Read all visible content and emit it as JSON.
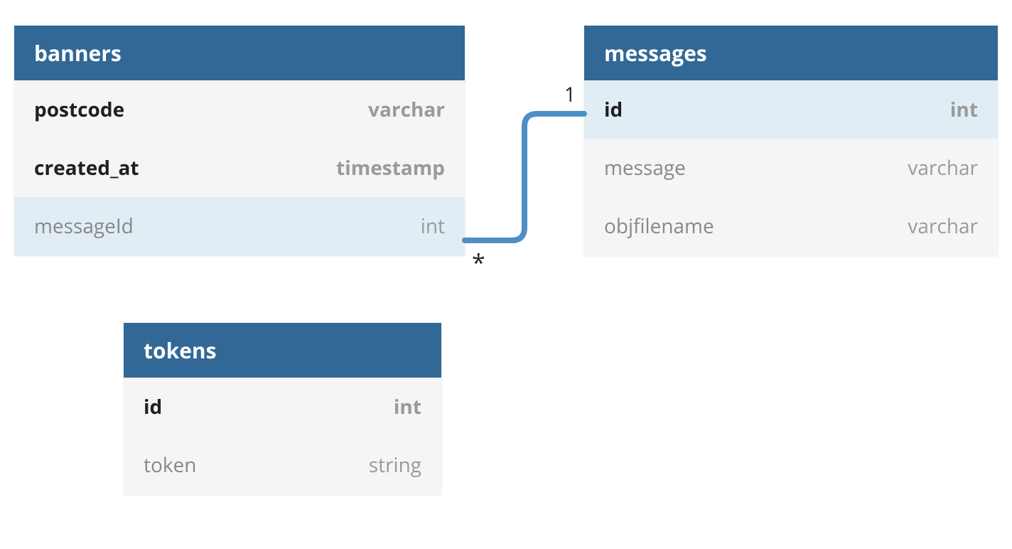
{
  "tables": {
    "banners": {
      "title": "banners",
      "columns": [
        {
          "name": "postcode",
          "type": "varchar",
          "bold": true
        },
        {
          "name": "created_at",
          "type": "timestamp",
          "bold": true
        },
        {
          "name": "messageId",
          "type": "int",
          "bold": false,
          "highlight": true
        }
      ]
    },
    "messages": {
      "title": "messages",
      "columns": [
        {
          "name": "id",
          "type": "int",
          "bold": true,
          "highlight": true
        },
        {
          "name": "message",
          "type": "varchar",
          "bold": false
        },
        {
          "name": "objfilename",
          "type": "varchar",
          "bold": false
        }
      ]
    },
    "tokens": {
      "title": "tokens",
      "columns": [
        {
          "name": "id",
          "type": "int",
          "bold": true
        },
        {
          "name": "token",
          "type": "string",
          "bold": false
        }
      ]
    }
  },
  "relationship": {
    "from_table": "banners",
    "from_column": "messageId",
    "to_table": "messages",
    "to_column": "id",
    "from_cardinality": "*",
    "to_cardinality": "1"
  },
  "colors": {
    "header_bg": "#316896",
    "header_text": "#ffffff",
    "row_bg": "#f5f5f5",
    "row_highlight": "#e0edf4",
    "connector": "#4d8fc4"
  }
}
